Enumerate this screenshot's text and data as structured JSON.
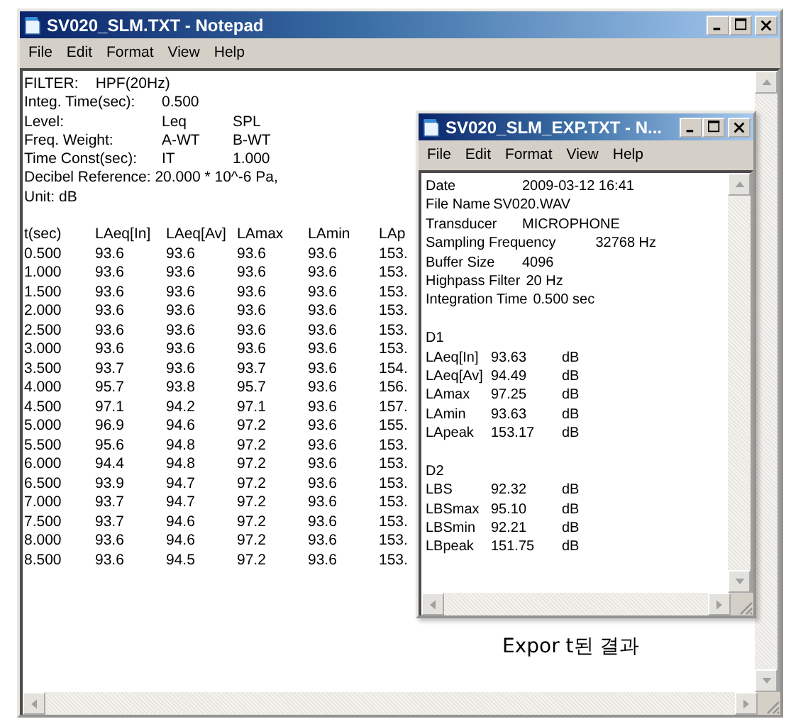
{
  "main_window": {
    "title": "SV020_SLM.TXT - Notepad",
    "menu": [
      "File",
      "Edit",
      "Format",
      "View",
      "Help"
    ],
    "header_lines": [
      {
        "kind": "pair",
        "cells": [
          "FILTER:",
          "HPF(20Hz)"
        ]
      },
      {
        "kind": "columns",
        "cells": [
          "Integ. Time(sec):",
          "0.500"
        ]
      },
      {
        "kind": "columns",
        "cells": [
          "Level:",
          "Leq",
          "SPL"
        ]
      },
      {
        "kind": "columns",
        "cells": [
          "Freq. Weight:",
          "A-WT",
          "B-WT"
        ]
      },
      {
        "kind": "columns",
        "cells": [
          "Time Const(sec):",
          "IT",
          "1.000"
        ]
      },
      {
        "kind": "text",
        "cells": [
          "Decibel Reference: 20.000 * 10^-6 Pa,"
        ]
      },
      {
        "kind": "text",
        "cells": [
          "Unit: dB"
        ]
      }
    ],
    "table": {
      "columns": [
        "t(sec)",
        "LAeq[In]",
        "LAeq[Av]",
        "LAmax",
        "LAmin",
        "LAp"
      ],
      "rows": [
        [
          "0.500",
          "93.6",
          "93.6",
          "93.6",
          "93.6",
          "153."
        ],
        [
          "1.000",
          "93.6",
          "93.6",
          "93.6",
          "93.6",
          "153."
        ],
        [
          "1.500",
          "93.6",
          "93.6",
          "93.6",
          "93.6",
          "153."
        ],
        [
          "2.000",
          "93.6",
          "93.6",
          "93.6",
          "93.6",
          "153."
        ],
        [
          "2.500",
          "93.6",
          "93.6",
          "93.6",
          "93.6",
          "153."
        ],
        [
          "3.000",
          "93.6",
          "93.6",
          "93.6",
          "93.6",
          "153."
        ],
        [
          "3.500",
          "93.7",
          "93.6",
          "93.7",
          "93.6",
          "154."
        ],
        [
          "4.000",
          "95.7",
          "93.8",
          "95.7",
          "93.6",
          "156."
        ],
        [
          "4.500",
          "97.1",
          "94.2",
          "97.1",
          "93.6",
          "157."
        ],
        [
          "5.000",
          "96.9",
          "94.6",
          "97.2",
          "93.6",
          "155."
        ],
        [
          "5.500",
          "95.6",
          "94.8",
          "97.2",
          "93.6",
          "153."
        ],
        [
          "6.000",
          "94.4",
          "94.8",
          "97.2",
          "93.6",
          "153."
        ],
        [
          "6.500",
          "93.9",
          "94.7",
          "97.2",
          "93.6",
          "153."
        ],
        [
          "7.000",
          "93.7",
          "94.7",
          "97.2",
          "93.6",
          "153."
        ],
        [
          "7.500",
          "93.7",
          "94.6",
          "97.2",
          "93.6",
          "153."
        ],
        [
          "8.000",
          "93.6",
          "94.6",
          "97.2",
          "93.6",
          "153."
        ],
        [
          "8.500",
          "93.6",
          "94.5",
          "97.2",
          "93.6",
          "153."
        ]
      ]
    }
  },
  "export_window": {
    "title": "SV020_SLM_EXP.TXT - N...",
    "menu": [
      "File",
      "Edit",
      "Format",
      "View",
      "Help"
    ],
    "lines": [
      {
        "kind": "field",
        "cells": [
          "Date",
          "2009-03-12  16:41"
        ]
      },
      {
        "kind": "inline",
        "cells": [
          "File Name",
          "SV020.WAV"
        ]
      },
      {
        "kind": "field",
        "cells": [
          "Transducer",
          "MICROPHONE"
        ]
      },
      {
        "kind": "wide",
        "cells": [
          "Sampling Frequency",
          "32768 Hz"
        ]
      },
      {
        "kind": "field",
        "cells": [
          "Buffer Size",
          "4096"
        ]
      },
      {
        "kind": "field",
        "cells": [
          "Highpass Filter",
          "20 Hz"
        ]
      },
      {
        "kind": "field",
        "cells": [
          "Integration Time",
          "0.500 sec"
        ]
      },
      {
        "kind": "blank"
      },
      {
        "kind": "section",
        "cells": [
          "D1"
        ]
      },
      {
        "kind": "measure",
        "cells": [
          "LAeq[In]",
          "93.63",
          "dB"
        ]
      },
      {
        "kind": "measure",
        "cells": [
          "LAeq[Av]",
          "94.49",
          "dB"
        ]
      },
      {
        "kind": "measure",
        "cells": [
          "LAmax",
          "97.25",
          "dB"
        ]
      },
      {
        "kind": "measure",
        "cells": [
          "LAmin",
          "93.63",
          "dB"
        ]
      },
      {
        "kind": "measure",
        "cells": [
          "LApeak",
          "153.17",
          "dB"
        ]
      },
      {
        "kind": "blank"
      },
      {
        "kind": "section",
        "cells": [
          "D2"
        ]
      },
      {
        "kind": "measure",
        "cells": [
          "LBS",
          "92.32",
          "dB"
        ]
      },
      {
        "kind": "measure",
        "cells": [
          "LBSmax",
          "95.10",
          "dB"
        ]
      },
      {
        "kind": "measure",
        "cells": [
          "LBSmin",
          "92.21",
          "dB"
        ]
      },
      {
        "kind": "measure",
        "cells": [
          "LBpeak",
          "151.75",
          "dB"
        ]
      }
    ]
  },
  "caption": "Expor t된  결과"
}
